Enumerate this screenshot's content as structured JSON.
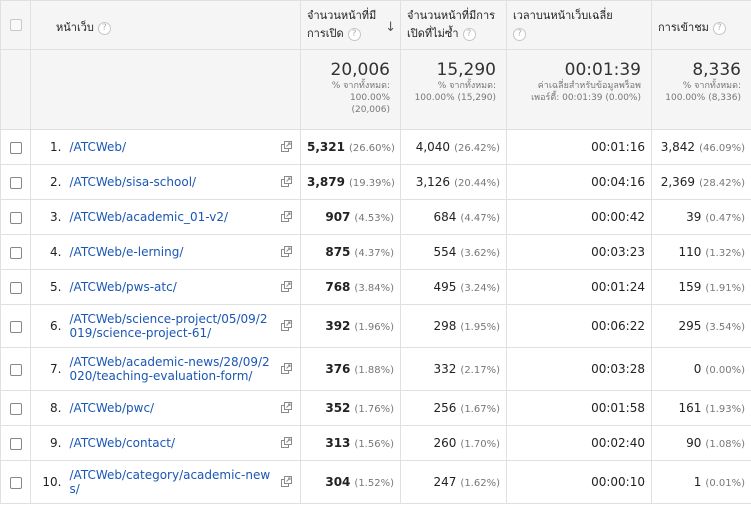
{
  "columns": {
    "page": "หน้าเว็บ",
    "pageviews": [
      "จำนวนหน้าที่มี",
      "การเปิด"
    ],
    "unique_pageviews": [
      "จำนวนหน้าที่มีการ",
      "เปิดที่ไม่ซ้ำ"
    ],
    "avg_time": "เวลาบนหน้าเว็บเฉลี่ย",
    "entrances": "การเข้าชม"
  },
  "totals": {
    "pageviews": {
      "value": "20,006",
      "sub": [
        "% จากทั้งหมด:",
        "100.00%",
        "(20,006)"
      ]
    },
    "unique_pageviews": {
      "value": "15,290",
      "sub": [
        "% จากทั้งหมด:",
        "100.00% (15,290)"
      ]
    },
    "avg_time": {
      "value": "00:01:39",
      "sub": [
        "ค่าเฉลี่ยสำหรับข้อมูลพร็อพ",
        "เพอร์ตี้: 00:01:39 (0.00%)"
      ]
    },
    "entrances": {
      "value": "8,336",
      "sub": [
        "% จากทั้งหมด:",
        "100.00% (8,336)"
      ]
    }
  },
  "rows": [
    {
      "idx": "1.",
      "page": [
        "/ATCWeb/"
      ],
      "pv": "5,321",
      "pv_pct": "(26.60%)",
      "upv": "4,040",
      "upv_pct": "(26.42%)",
      "time": "00:01:16",
      "ent": "3,842",
      "ent_pct": "(46.09%)"
    },
    {
      "idx": "2.",
      "page": [
        "/ATCWeb/sisa-school/"
      ],
      "pv": "3,879",
      "pv_pct": "(19.39%)",
      "upv": "3,126",
      "upv_pct": "(20.44%)",
      "time": "00:04:16",
      "ent": "2,369",
      "ent_pct": "(28.42%)"
    },
    {
      "idx": "3.",
      "page": [
        "/ATCWeb/academic_01-v2/"
      ],
      "pv": "907",
      "pv_pct": "(4.53%)",
      "upv": "684",
      "upv_pct": "(4.47%)",
      "time": "00:00:42",
      "ent": "39",
      "ent_pct": "(0.47%)"
    },
    {
      "idx": "4.",
      "page": [
        "/ATCWeb/e-lerning/"
      ],
      "pv": "875",
      "pv_pct": "(4.37%)",
      "upv": "554",
      "upv_pct": "(3.62%)",
      "time": "00:03:23",
      "ent": "110",
      "ent_pct": "(1.32%)"
    },
    {
      "idx": "5.",
      "page": [
        "/ATCWeb/pws-atc/"
      ],
      "pv": "768",
      "pv_pct": "(3.84%)",
      "upv": "495",
      "upv_pct": "(3.24%)",
      "time": "00:01:24",
      "ent": "159",
      "ent_pct": "(1.91%)"
    },
    {
      "idx": "6.",
      "page": [
        "/ATCWeb/science-project/05/09/2",
        "019/science-project-61/"
      ],
      "pv": "392",
      "pv_pct": "(1.96%)",
      "upv": "298",
      "upv_pct": "(1.95%)",
      "time": "00:06:22",
      "ent": "295",
      "ent_pct": "(3.54%)"
    },
    {
      "idx": "7.",
      "page": [
        "/ATCWeb/academic-news/28/09/2",
        "020/teaching-evaluation-form/"
      ],
      "pv": "376",
      "pv_pct": "(1.88%)",
      "upv": "332",
      "upv_pct": "(2.17%)",
      "time": "00:03:28",
      "ent": "0",
      "ent_pct": "(0.00%)"
    },
    {
      "idx": "8.",
      "page": [
        "/ATCWeb/pwc/"
      ],
      "pv": "352",
      "pv_pct": "(1.76%)",
      "upv": "256",
      "upv_pct": "(1.67%)",
      "time": "00:01:58",
      "ent": "161",
      "ent_pct": "(1.93%)"
    },
    {
      "idx": "9.",
      "page": [
        "/ATCWeb/contact/"
      ],
      "pv": "313",
      "pv_pct": "(1.56%)",
      "upv": "260",
      "upv_pct": "(1.70%)",
      "time": "00:02:40",
      "ent": "90",
      "ent_pct": "(1.08%)"
    },
    {
      "idx": "10.",
      "page": [
        "/ATCWeb/category/academic-new",
        "s/"
      ],
      "pv": "304",
      "pv_pct": "(1.52%)",
      "upv": "247",
      "upv_pct": "(1.62%)",
      "time": "00:00:10",
      "ent": "1",
      "ent_pct": "(0.01%)"
    }
  ]
}
